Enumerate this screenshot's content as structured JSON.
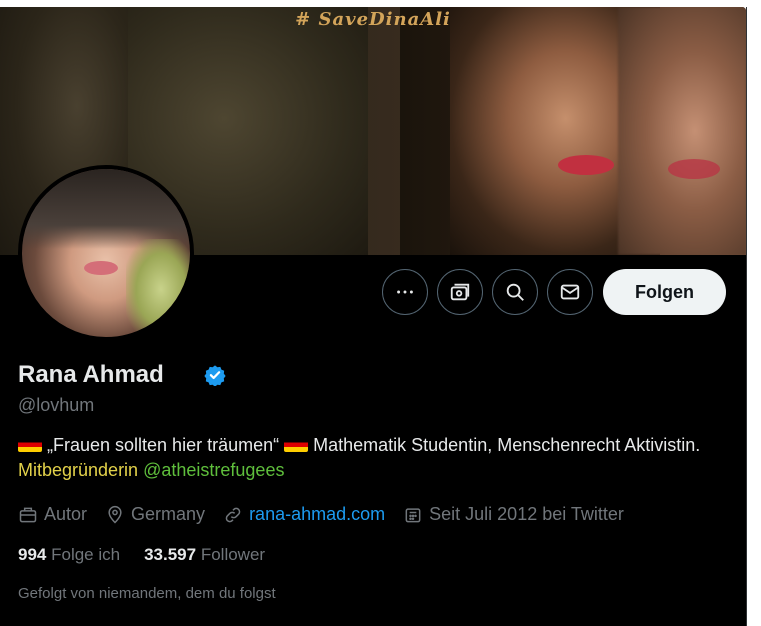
{
  "banner": {
    "hashtag": "# SaveDinaAli"
  },
  "actions": {
    "more_icon": "more-icon",
    "subscribe_icon": "subscriptions-icon",
    "search_icon": "search-icon",
    "message_icon": "mail-icon",
    "follow_label": "Folgen"
  },
  "profile": {
    "display_name": "Rana Ahmad",
    "name_emoji": "🛰",
    "handle": "@lovhum",
    "bio": {
      "part1": " „Frauen sollten hier träumen“ ",
      "part2": " Mathematik Studentin, Menschenrecht Aktivistin. ",
      "cofounder": "Mitbegründerin",
      "mention": "@atheistrefugees"
    },
    "meta": {
      "profession": "Autor",
      "location": "Germany",
      "website": "rana-ahmad.com",
      "joined": "Seit Juli 2012 bei Twitter"
    },
    "following_count": "994",
    "following_label": "Folge ich",
    "followers_count": "33.597",
    "followers_label": "Follower",
    "followed_by": "Gefolgt von niemandem, dem du folgst"
  },
  "colors": {
    "background": "#000000",
    "accent": "#1d9bf0",
    "text": "#e7e9ea",
    "muted": "#71767b"
  }
}
